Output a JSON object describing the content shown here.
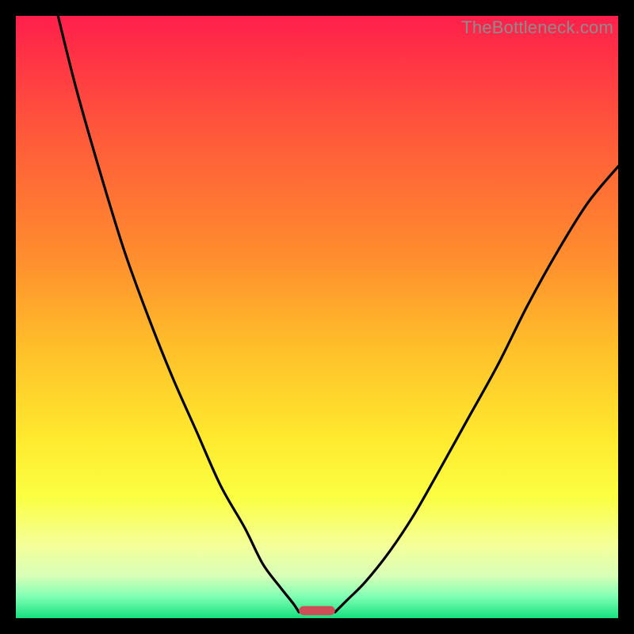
{
  "watermark": "TheBottleneck.com",
  "chart_data": {
    "type": "line",
    "title": "",
    "xlabel": "",
    "ylabel": "",
    "xlim": [
      0,
      100
    ],
    "ylim": [
      0,
      100
    ],
    "gradient_stops": [
      {
        "offset": 0.0,
        "color": "#ff1f4b"
      },
      {
        "offset": 0.2,
        "color": "#ff5a3a"
      },
      {
        "offset": 0.4,
        "color": "#ff8d2e"
      },
      {
        "offset": 0.55,
        "color": "#ffbf2a"
      },
      {
        "offset": 0.7,
        "color": "#ffe92e"
      },
      {
        "offset": 0.8,
        "color": "#fbff42"
      },
      {
        "offset": 0.88,
        "color": "#f4ff9a"
      },
      {
        "offset": 0.93,
        "color": "#d8ffb8"
      },
      {
        "offset": 0.965,
        "color": "#7dffb3"
      },
      {
        "offset": 1.0,
        "color": "#16e07f"
      }
    ],
    "series": [
      {
        "name": "left-curve",
        "x": [
          7.0,
          10.0,
          14.0,
          18.0,
          22.0,
          26.0,
          30.0,
          34.0,
          38.0,
          41.0,
          44.0,
          46.0,
          47.0
        ],
        "y": [
          100.0,
          88.0,
          74.0,
          61.0,
          50.0,
          40.0,
          31.0,
          22.0,
          15.0,
          9.0,
          5.0,
          2.5,
          1.0
        ]
      },
      {
        "name": "right-curve",
        "x": [
          53.0,
          55.0,
          58.0,
          62.0,
          66.0,
          70.0,
          75.0,
          80.0,
          85.0,
          90.0,
          95.0,
          100.0
        ],
        "y": [
          1.0,
          3.0,
          6.0,
          11.0,
          17.0,
          24.0,
          33.0,
          42.0,
          52.0,
          61.0,
          69.0,
          75.0
        ]
      }
    ],
    "marker": {
      "name": "optimum-marker",
      "x_center": 50.0,
      "width": 6.0,
      "y": 0.5,
      "height": 1.5,
      "color": "#cf4d57"
    }
  }
}
